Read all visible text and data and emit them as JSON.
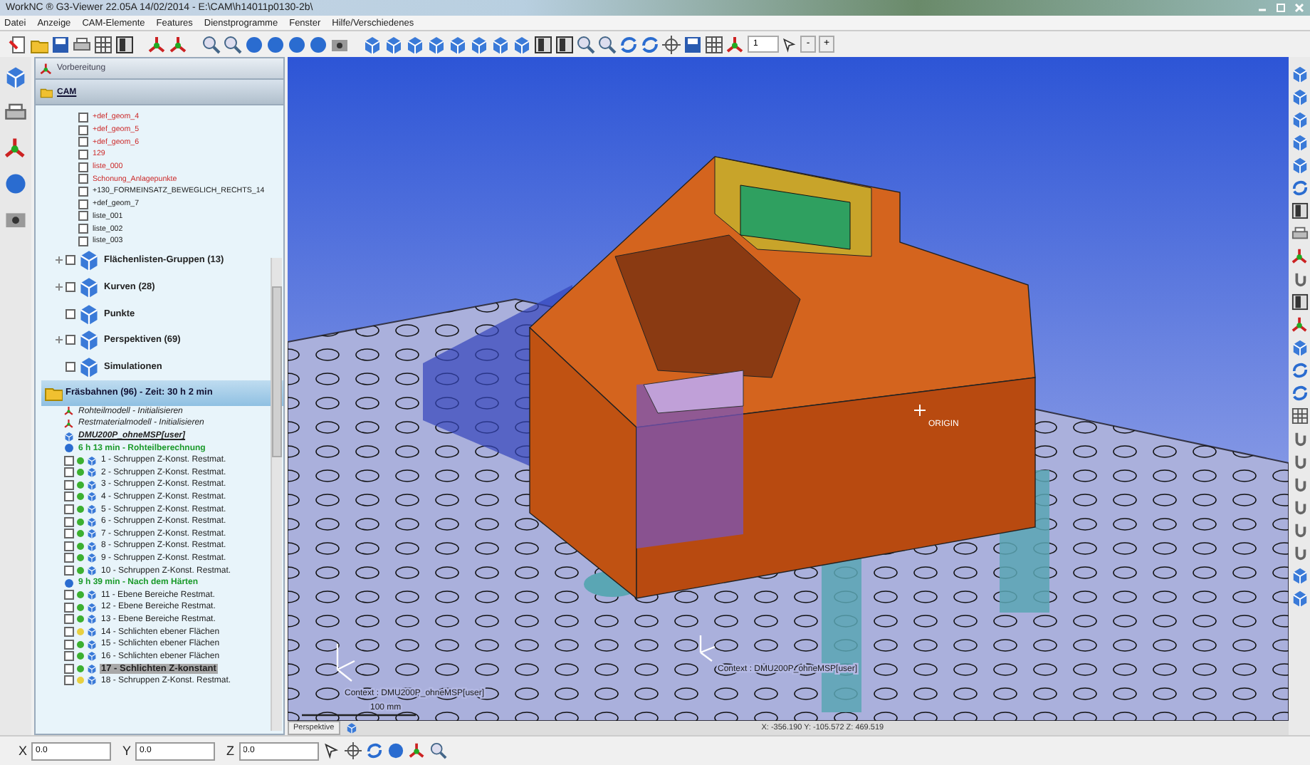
{
  "window": {
    "title": "WorkNC ® G3-Viewer 22.05A   14/02/2014 - E:\\CAM\\h14011p0130-2b\\"
  },
  "menu": [
    "Datei",
    "Anzeige",
    "CAM-Elemente",
    "Features",
    "Dienstprogramme",
    "Fenster",
    "Hilfe/Verschiedenes"
  ],
  "toolbar": {
    "zoom_value": "1",
    "buttons": [
      "-",
      "+"
    ]
  },
  "panel": {
    "tabs": [
      {
        "label": "Vorbereitung",
        "selected": false
      },
      {
        "label": "CAM",
        "selected": true
      }
    ],
    "geometry_lists": [
      {
        "label": "+def_geom_4",
        "highlighted": true,
        "checked": false
      },
      {
        "label": "+def_geom_5",
        "highlighted": true,
        "checked": false
      },
      {
        "label": "+def_geom_6",
        "highlighted": true,
        "checked": false
      },
      {
        "label": "129",
        "highlighted": true,
        "checked": false
      },
      {
        "label": "liste_000",
        "highlighted": true,
        "checked": false
      },
      {
        "label": "Schonung_Anlagepunkte",
        "highlighted": true,
        "checked": false
      },
      {
        "label": "+130_FORMEINSATZ_BEWEGLICH_RECHTS_14",
        "highlighted": false,
        "checked": false
      },
      {
        "label": "+def_geom_7",
        "highlighted": false,
        "checked": false
      },
      {
        "label": "liste_001",
        "highlighted": false,
        "checked": false
      },
      {
        "label": "liste_002",
        "highlighted": false,
        "checked": false
      },
      {
        "label": "liste_003",
        "highlighted": false,
        "checked": false
      }
    ],
    "groups": [
      {
        "label": "Flächenlisten-Gruppen (13)",
        "collapsed": true,
        "checked": false
      },
      {
        "label": "Kurven (28)",
        "collapsed": true,
        "checked": false
      },
      {
        "label": "Punkte",
        "collapsed": false,
        "checked": false
      },
      {
        "label": "Perspektiven (69)",
        "collapsed": true,
        "checked": false
      },
      {
        "label": "Simulationen",
        "collapsed": false,
        "checked": false
      }
    ],
    "toolpaths": {
      "label": "Fräsbahnen (96) - Zeit: 30 h 2 min",
      "items": [
        {
          "kind": "model",
          "label": "Rohteilmodell - Initialisieren"
        },
        {
          "kind": "model",
          "label": "Restmaterialmodell - Initialisieren"
        },
        {
          "kind": "machine",
          "label": "DMU200P_ohneMSP[user]"
        },
        {
          "kind": "group",
          "label": "6 h 13 min - Rohteilberechnung",
          "children": [
            {
              "label": "1 - Schruppen Z-Konst. Restmat.",
              "color": "#3cb030",
              "selected": false,
              "checked": false
            },
            {
              "label": "2 - Schruppen Z-Konst. Restmat.",
              "color": "#3cb030",
              "selected": false,
              "checked": false
            },
            {
              "label": "3 - Schruppen Z-Konst. Restmat.",
              "color": "#3cb030",
              "selected": false,
              "checked": false
            },
            {
              "label": "4 - Schruppen Z-Konst. Restmat.",
              "color": "#3cb030",
              "selected": false,
              "checked": false
            },
            {
              "label": "5 - Schruppen Z-Konst. Restmat.",
              "color": "#3cb030",
              "selected": false,
              "checked": false
            },
            {
              "label": "6 - Schruppen Z-Konst. Restmat.",
              "color": "#3cb030",
              "selected": false,
              "checked": false
            },
            {
              "label": "7 - Schruppen Z-Konst. Restmat.",
              "color": "#3cb030",
              "selected": false,
              "checked": false
            },
            {
              "label": "8 - Schruppen Z-Konst. Restmat.",
              "color": "#3cb030",
              "selected": false,
              "checked": false
            },
            {
              "label": "9 - Schruppen Z-Konst. Restmat.",
              "color": "#3cb030",
              "selected": false,
              "checked": false
            },
            {
              "label": "10 - Schruppen Z-Konst. Restmat.",
              "color": "#3cb030",
              "selected": false,
              "checked": false
            }
          ]
        },
        {
          "kind": "group",
          "label": "9 h 39 min - Nach dem Härten",
          "children": [
            {
              "label": "11 - Ebene Bereiche Restmat.",
              "color": "#3cb030",
              "selected": false,
              "checked": false
            },
            {
              "label": "12 - Ebene Bereiche Restmat.",
              "color": "#3cb030",
              "selected": false,
              "checked": false
            },
            {
              "label": "13 - Ebene Bereiche Restmat.",
              "color": "#3cb030",
              "selected": false,
              "checked": false
            },
            {
              "label": "14 - Schlichten ebener Flächen",
              "color": "#e8d040",
              "selected": false,
              "checked": false
            },
            {
              "label": "15 - Schlichten ebener Flächen",
              "color": "#3cb030",
              "selected": false,
              "checked": false
            },
            {
              "label": "16 - Schlichten ebener Flächen",
              "color": "#3cb030",
              "selected": false,
              "checked": false
            },
            {
              "label": "17 - Schlichten Z-konstant",
              "color": "#3cb030",
              "selected": true,
              "checked": false
            },
            {
              "label": "18 - Schruppen Z-Konst. Restmat.",
              "color": "#e8d040",
              "selected": false,
              "checked": false
            }
          ]
        }
      ]
    }
  },
  "viewport": {
    "origin_label": "ORIGIN",
    "context_labels": [
      "Context : DMU200P_ohneMSP[user]",
      "Context : DMU200P_ohneMSP[user]"
    ],
    "scale_label": "100 mm",
    "view_tab": "Perspektive",
    "coordinates": "X: -356.190  Y: -105.572  Z: 469.519"
  },
  "coordinate_bar": [
    {
      "label": "X",
      "value": "0.0"
    },
    {
      "label": "Y",
      "value": "0.0"
    },
    {
      "label": "Z",
      "value": "0.0"
    }
  ]
}
